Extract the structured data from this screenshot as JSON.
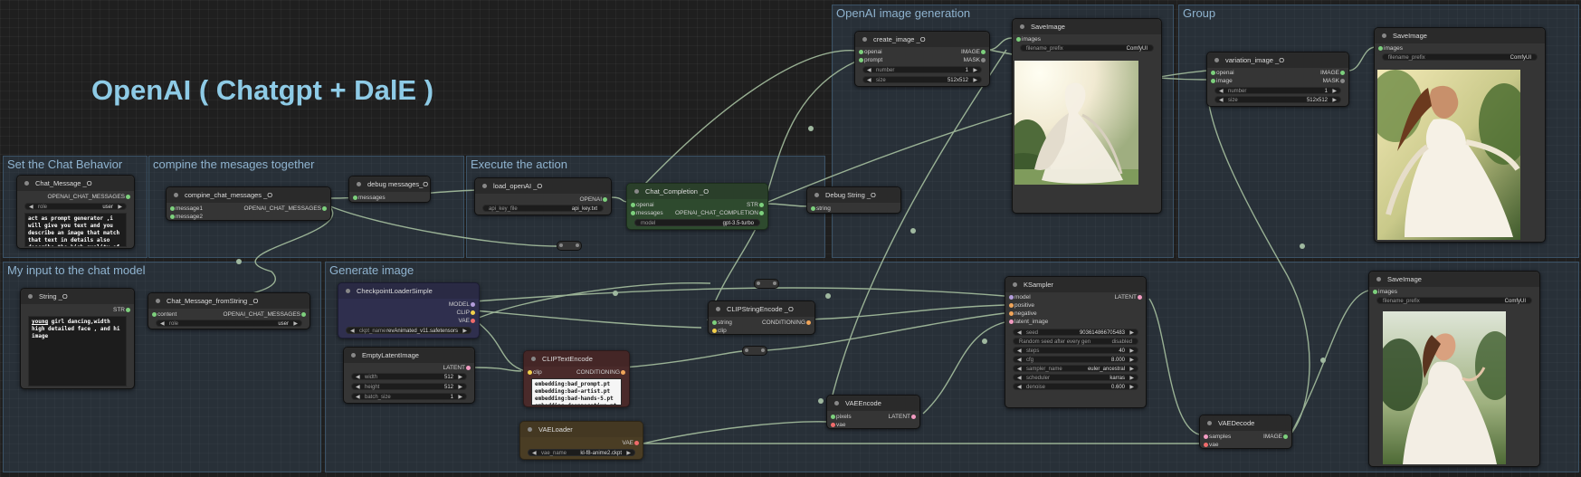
{
  "canvas": {
    "title": "OpenAI ( Chatgpt + DalE )",
    "groups": {
      "openai_image_generation": "OpenAI image generation",
      "group": "Group",
      "set_chat_behavior": "Set the Chat Behavior",
      "compine_messages": "compine the mesages together",
      "execute_action": "Execute the action",
      "my_input": "My input to the chat model",
      "generate_image": "Generate image"
    }
  },
  "nodes": {
    "chat_message": {
      "title": "Chat_Message _O",
      "output": "OPENAI_CHAT_MESSAGES",
      "role_label": "role",
      "role_value": "user",
      "text": "act as prompt generator ,i will give you text and you describe an image that match that text in details also describe the high quality of the image , answer with one response only"
    },
    "compine": {
      "title": "compine_chat_messages _O",
      "in1": "message1",
      "in2": "message2",
      "output": "OPENAI_CHAT_MESSAGES"
    },
    "debug_messages": {
      "title": "debug messages_O",
      "in": "messages"
    },
    "load_openai": {
      "title": "load_openAI _O",
      "output": "OPENAI",
      "widget_label": "api_key_file",
      "widget_value": "api_key.txt"
    },
    "chat_completion": {
      "title": "Chat_Completion _O",
      "in1": "openai",
      "in2": "messages",
      "out1": "STR",
      "out2": "OPENAI_CHAT_COMPLETION",
      "widget_label": "model",
      "widget_value": "gpt-3.5-turbo"
    },
    "debug_string": {
      "title": "Debug String _O",
      "in": "string"
    },
    "create_image": {
      "title": "create_image _O",
      "in1": "openai",
      "in2": "prompt",
      "out1": "IMAGE",
      "out2": "MASK",
      "w1_label": "number",
      "w1_value": "1",
      "w2_label": "size",
      "w2_value": "512x512"
    },
    "save_image_1": {
      "title": "SaveImage",
      "in": "images",
      "widget_label": "filename_prefix",
      "widget_value": "ComfyUI"
    },
    "variation_image": {
      "title": "variation_image _O",
      "in1": "openai",
      "in2": "image",
      "out1": "IMAGE",
      "out2": "MASK",
      "w1_label": "number",
      "w1_value": "1",
      "w2_label": "size",
      "w2_value": "512x512"
    },
    "save_image_2": {
      "title": "SaveImage",
      "in": "images",
      "widget_label": "filename_prefix",
      "widget_value": "ComfyUI"
    },
    "string_o": {
      "title": "String _O",
      "output": "STR",
      "text_highlight": "young",
      "text": " girl dancing,width high detailed face , and hi image"
    },
    "chat_message_from_string": {
      "title": "Chat_Message_fromString _O",
      "in": "content",
      "output": "OPENAI_CHAT_MESSAGES",
      "role_label": "role",
      "role_value": "user"
    },
    "checkpoint_loader": {
      "title": "CheckpointLoaderSimple",
      "out1": "MODEL",
      "out2": "CLIP",
      "out3": "VAE",
      "widget_label": "ckpt_name",
      "widget_value": "revAnimated_v11.safetensors"
    },
    "clip_string_encode": {
      "title": "CLIPStringEncode _O",
      "in1": "string",
      "in2": "clip",
      "output": "CONDITIONING"
    },
    "empty_latent": {
      "title": "EmptyLatentImage",
      "output": "LATENT",
      "w1_label": "width",
      "w1_value": "512",
      "w2_label": "height",
      "w2_value": "512",
      "w3_label": "batch_size",
      "w3_value": "1"
    },
    "clip_text_encode": {
      "title": "CLIPTextEncode",
      "in": "clip",
      "output": "CONDITIONING",
      "text": "embedding:bad_prompt.pt\nembedding:bad-artist.pt\nembedding:bad-hands-5.pt\nembedding:deepnegative.pt\nembedding:easynegative.pt"
    },
    "ksampler": {
      "title": "KSampler",
      "in1": "model",
      "in2": "positive",
      "in3": "negative",
      "in4": "latent_image",
      "output": "LATENT",
      "seed_label": "seed",
      "seed_value": "903614866705483",
      "control_label": "Random seed after every gen",
      "control_value": "disabled",
      "steps_label": "steps",
      "steps_value": "40",
      "cfg_label": "cfg",
      "cfg_value": "8.000",
      "sampler_label": "sampler_name",
      "sampler_value": "euler_ancestral",
      "scheduler_label": "scheduler",
      "scheduler_value": "karras",
      "denoise_label": "denoise",
      "denoise_value": "0.600"
    },
    "vae_encode": {
      "title": "VAEEncode",
      "in1": "pixels",
      "in2": "vae",
      "output": "LATENT"
    },
    "vae_loader": {
      "title": "VAELoader",
      "output": "VAE",
      "widget_label": "vae_name",
      "widget_value": "kl-f8-anime2.ckpt"
    },
    "vae_decode": {
      "title": "VAEDecode",
      "in1": "samples",
      "in2": "vae",
      "output": "IMAGE"
    },
    "save_image_3": {
      "title": "SaveImage",
      "in": "images",
      "widget_label": "filename_prefix",
      "widget_value": "ComfyUI"
    }
  },
  "colors": {
    "socket_green": "#7dd07d",
    "group_title": "#8fb3cf",
    "big_title": "#8ecbe6",
    "chat_completion_bg": "#2e4a2e",
    "checkpoint_bg": "#2f2f4e",
    "clip_text_bg": "#4a2a2a",
    "vae_loader_bg": "#4a3d24"
  }
}
